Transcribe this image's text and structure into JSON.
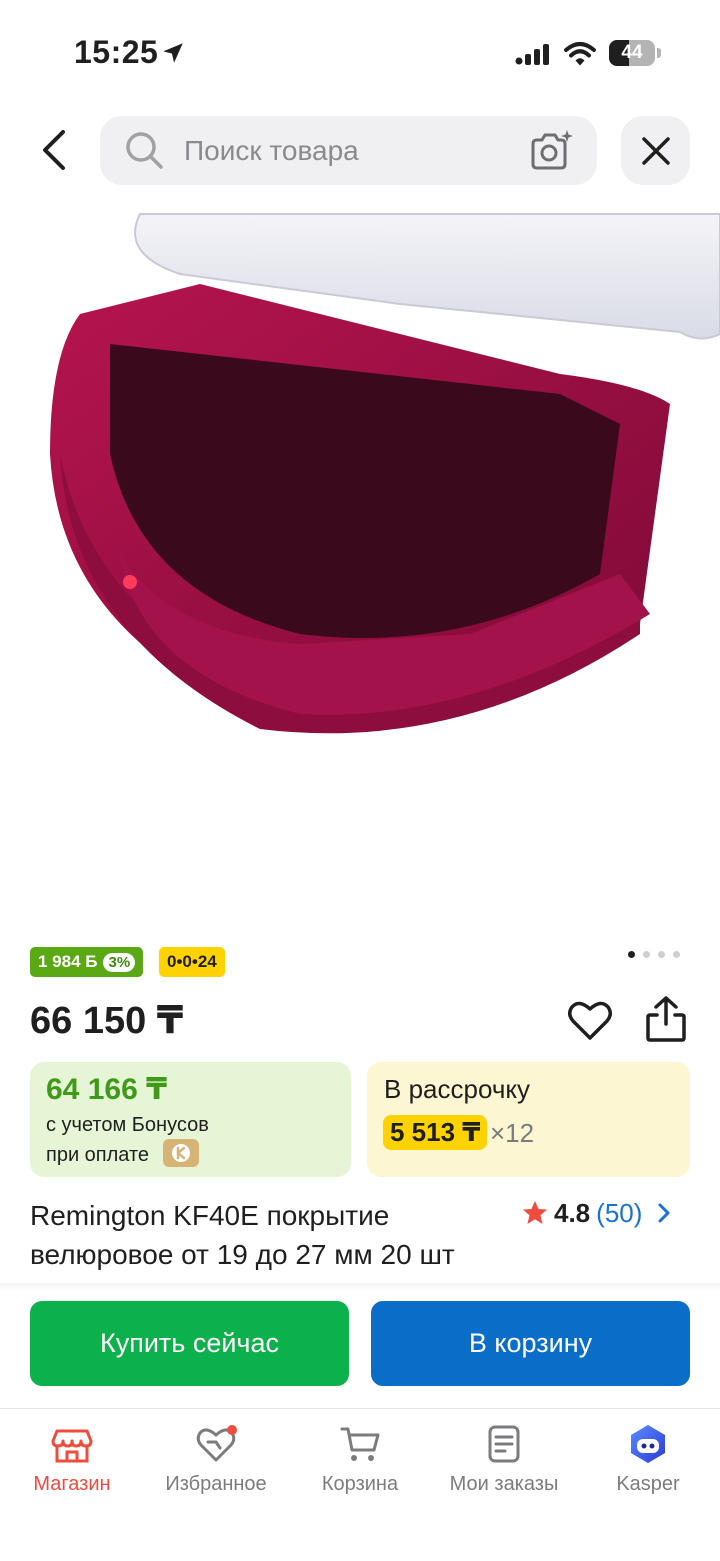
{
  "status_bar": {
    "time": "15:25",
    "battery": "44",
    "battery_level": 0.44
  },
  "search": {
    "placeholder": "Поиск товара"
  },
  "badges": {
    "bonus_amount": "1 984 Б",
    "bonus_percent": "3%",
    "installment_plan": "0•0•24"
  },
  "gallery": {
    "image_count": 4,
    "active_index": 0
  },
  "product": {
    "price": "66 150 ₸",
    "title": "Remington KF40E покрытие велюровое от 19 до 27 мм 20 шт",
    "rating": "4.8",
    "reviews": "(50)"
  },
  "bonus_card": {
    "price": "64 166 ₸",
    "line1": "с учетом Бонусов",
    "line2": "при оплате"
  },
  "installment_card": {
    "title": "В рассрочку",
    "amount": "5 513 ₸",
    "multiplier": "×12"
  },
  "actions": {
    "buy_now": "Купить сейчас",
    "add_to_cart": "В корзину"
  },
  "bottom_nav": {
    "items": [
      {
        "label": "Магазин",
        "icon": "shop-icon",
        "active": true
      },
      {
        "label": "Избранное",
        "icon": "heart-icon",
        "active": false
      },
      {
        "label": "Корзина",
        "icon": "cart-icon",
        "active": false
      },
      {
        "label": "Мои заказы",
        "icon": "orders-icon",
        "active": false
      },
      {
        "label": "Kasper",
        "icon": "kasper-icon",
        "active": false
      }
    ]
  },
  "colors": {
    "accent_red": "#f04c3e",
    "buy_green": "#0db14b",
    "cart_blue": "#0a6ec8",
    "bonus_green": "#5aa814",
    "installment_yellow": "#ffd200",
    "link_blue": "#1673d3"
  }
}
